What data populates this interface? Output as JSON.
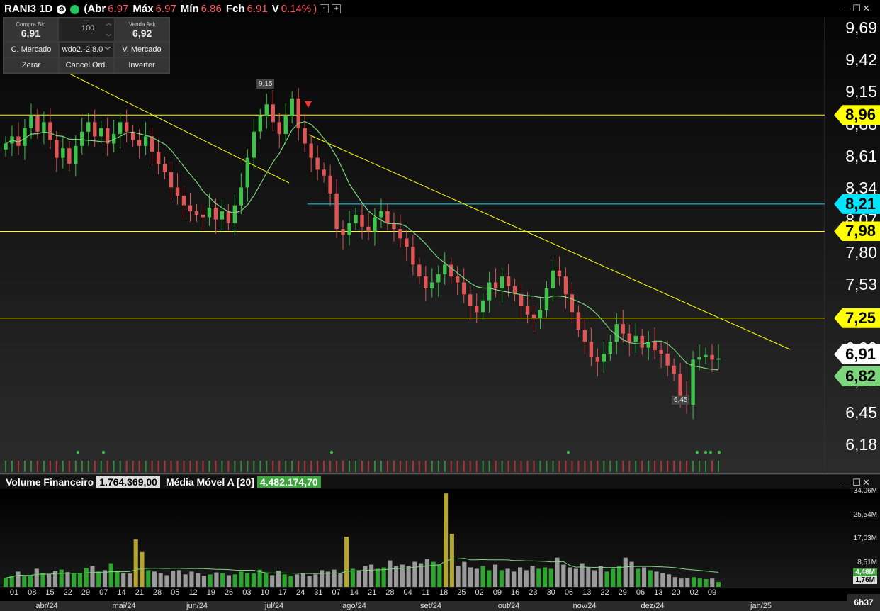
{
  "header": {
    "symbol": "RANI3",
    "interval": "1D",
    "open_label": "(Abr",
    "open_value": "6.97",
    "high_label": "Máx",
    "high_value": "6.97",
    "low_label": "Mín",
    "low_value": "6.86",
    "close_label": "Fch",
    "close_value": "6.91",
    "var_label": "V",
    "var_value": "0.14%",
    "close_paren": ")"
  },
  "order_panel": {
    "bid_label": "Compra Bid",
    "bid_value": "6,91",
    "qty_value": "100",
    "ask_label": "Venda Ask",
    "ask_value": "6,92",
    "buy_market": "C. Mercado",
    "account": "wdo2.-2;8.0",
    "sell_market": "V. Mercado",
    "zero": "Zerar",
    "cancel": "Cancel Ord.",
    "invert": "Inverter"
  },
  "price_axis": [
    "9,69",
    "9,42",
    "9,15",
    "8,88",
    "8,61",
    "8,34",
    "8,07",
    "7,80",
    "7,53",
    "7,25",
    "6,99",
    "6,72",
    "6,45",
    "6,18"
  ],
  "price_tags": [
    {
      "label": "8,96",
      "color": "#ffff00"
    },
    {
      "label": "8,21",
      "color": "#00e5ff"
    },
    {
      "label": "7,98",
      "color": "#ffff00"
    },
    {
      "label": "7,25",
      "color": "#ffff00"
    },
    {
      "label": "6,91",
      "color": "#ffffff"
    },
    {
      "label": "6,82",
      "color": "#7CD67C"
    }
  ],
  "hilo_labels": {
    "high": "9,15",
    "low": "6,45"
  },
  "volume_header": {
    "label": "Volume Financeiro",
    "value": "1.764.369,00",
    "ma_label": "Média Móvel A [20]",
    "ma_value": "4.482.174,70"
  },
  "volume_axis": [
    "34,06M",
    "25,54M",
    "17,03M",
    "8,51M"
  ],
  "volume_tags": [
    {
      "label": "4,48M",
      "color": "#3ea33e"
    },
    {
      "label": "1,76M",
      "color": "#dddddd"
    }
  ],
  "x_days": [
    "01",
    "08",
    "15",
    "22",
    "29",
    "07",
    "14",
    "21",
    "28",
    "05",
    "12",
    "19",
    "26",
    "03",
    "10",
    "17",
    "24",
    "31",
    "07",
    "14",
    "21",
    "28",
    "04",
    "11",
    "18",
    "25",
    "02",
    "09",
    "16",
    "23",
    "30",
    "06",
    "13",
    "22",
    "29",
    "06",
    "13",
    "20",
    "02",
    "09"
  ],
  "x_months": [
    "abr/24",
    "mai/24",
    "jun/24",
    "jul/24",
    "ago/24",
    "set/24",
    "out/24",
    "nov/24",
    "dez/24",
    "jan/25"
  ],
  "time_remaining": "6h37",
  "colors": {
    "up": "#3fc24a",
    "down": "#e05555",
    "support": "#ffff00",
    "resistance_cyan": "#00e5ff",
    "ma": "#7CD67C"
  },
  "chart_data": {
    "type": "candlestick",
    "symbol": "RANI3",
    "ylim": [
      6.1,
      9.75
    ],
    "horizontal_levels": [
      8.96,
      8.21,
      7.98,
      7.25
    ],
    "last_close": 6.91,
    "moving_average_last": 6.82,
    "high": 9.15,
    "low": 6.45,
    "closes": [
      8.72,
      8.78,
      8.7,
      8.85,
      8.95,
      8.82,
      8.9,
      8.75,
      8.6,
      8.68,
      8.55,
      8.7,
      8.82,
      8.9,
      8.78,
      8.85,
      8.72,
      8.8,
      8.9,
      8.82,
      8.75,
      8.7,
      8.78,
      8.65,
      8.55,
      8.48,
      8.35,
      8.28,
      8.2,
      8.15,
      8.12,
      8.1,
      8.18,
      8.08,
      8.15,
      8.05,
      8.2,
      8.35,
      8.6,
      8.82,
      8.95,
      9.05,
      8.9,
      8.8,
      8.95,
      9.1,
      8.85,
      8.72,
      8.6,
      8.5,
      8.45,
      8.3,
      8.0,
      7.95,
      8.05,
      8.12,
      8.02,
      7.98,
      8.1,
      8.15,
      8.05,
      8.0,
      7.92,
      7.85,
      7.7,
      7.6,
      7.5,
      7.55,
      7.62,
      7.7,
      7.6,
      7.55,
      7.45,
      7.35,
      7.3,
      7.4,
      7.55,
      7.5,
      7.6,
      7.52,
      7.45,
      7.35,
      7.28,
      7.25,
      7.32,
      7.5,
      7.65,
      7.6,
      7.45,
      7.3,
      7.15,
      7.05,
      6.92,
      6.88,
      6.95,
      7.05,
      7.2,
      7.12,
      7.05,
      7.1,
      7.0,
      7.05,
      6.98,
      6.95,
      6.85,
      6.78,
      6.6,
      6.52,
      6.9,
      6.92,
      6.94,
      6.9,
      6.91
    ]
  },
  "volume_data": {
    "values": [
      3.2,
      4.0,
      5.5,
      3.8,
      4.2,
      6.5,
      5.0,
      4.5,
      5.8,
      6.2,
      5.3,
      4.8,
      5.0,
      6.8,
      7.5,
      5.5,
      6.0,
      8.5,
      5.8,
      5.0,
      4.8,
      17.0,
      12.5,
      6.0,
      5.5,
      5.0,
      4.2,
      5.8,
      6.0,
      4.5,
      5.5,
      5.0,
      4.0,
      4.5,
      5.2,
      5.0,
      4.2,
      4.5,
      5.5,
      5.0,
      4.8,
      6.2,
      5.0,
      4.2,
      5.8,
      4.5,
      3.8,
      4.5,
      5.0,
      4.0,
      4.5,
      6.0,
      5.5,
      6.2,
      4.8,
      18.0,
      6.5,
      6.0,
      7.5,
      8.0,
      6.5,
      7.0,
      9.5,
      7.5,
      8.0,
      7.5,
      9.0,
      8.5,
      10.0,
      9.0,
      8.0,
      33.5,
      19.0,
      7.5,
      9.0,
      7.0,
      6.5,
      7.5,
      6.0,
      8.0,
      6.0,
      6.5,
      5.5,
      7.0,
      6.0,
      7.5,
      6.5,
      7.0,
      6.5,
      10.5,
      8.0,
      7.0,
      6.5,
      8.5,
      7.0,
      6.0,
      7.5,
      5.5,
      6.5,
      7.5,
      10.5,
      9.0,
      6.5,
      7.0,
      6.0,
      5.5,
      5.0,
      4.5,
      3.5,
      3.0,
      3.2,
      3.5,
      3.0,
      2.8,
      3.0,
      1.76
    ],
    "moving_average": 4.48
  }
}
